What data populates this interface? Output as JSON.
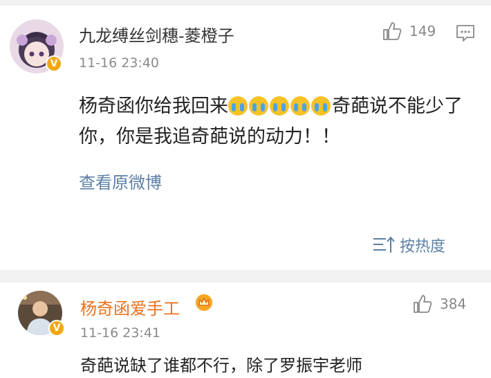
{
  "comment1": {
    "username": "九龙缚丝剑穗-菱橙子",
    "time": "11-16 23:40",
    "likes": "149",
    "text_before": "杨奇函你给我回来",
    "text_after": "奇葩说不能少了你，你是我追奇葩说的动力！！",
    "emoji_count": 5,
    "emoji_name": "crying-face-emoji",
    "view_original": "查看原微博",
    "avatar_icon": "anime-avatar",
    "verified_icon": "verified-v-badge"
  },
  "sort": {
    "label": "按热度",
    "icon": "sort-icon"
  },
  "comment2": {
    "username": "杨奇函爱手工",
    "time": "11-16 23:41",
    "likes": "384",
    "text": "奇葩说缺了谁都不行，除了罗振宇老师",
    "avatar_icon": "user-photo-avatar",
    "vip_icon": "crown-vip-icon"
  },
  "icons": {
    "like": "thumbs-up-icon",
    "reply": "comment-icon"
  },
  "colors": {
    "link_blue": "#5b7fa6",
    "vip_orange": "#e8721c",
    "badge_gold": "#f3a712"
  }
}
